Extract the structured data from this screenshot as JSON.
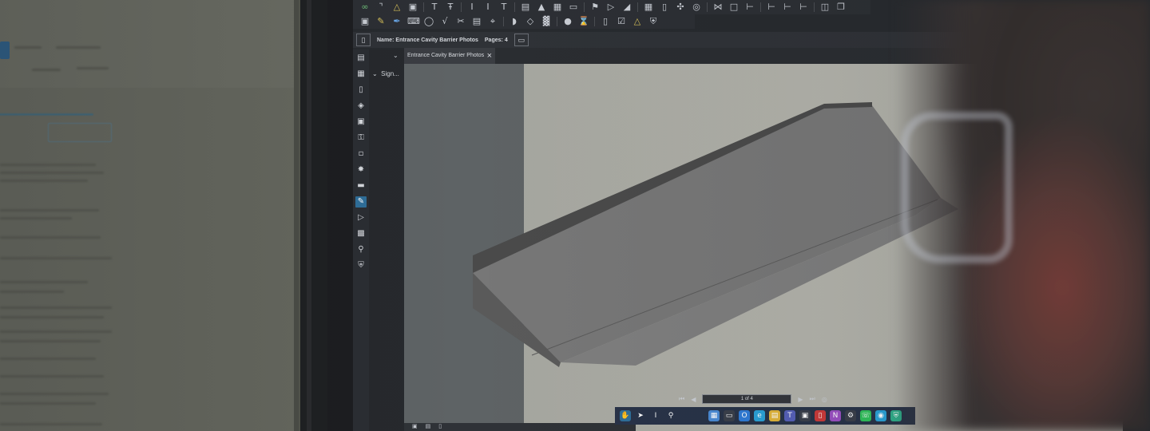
{
  "app": {
    "document_bar": {
      "name_label": "Name:",
      "name_value": "Entrance Cavity Barrier Photos",
      "pages_label": "Pages:",
      "pages_value": "4"
    },
    "tab": {
      "title": "Entrance Cavity Barrier Photos",
      "close_glyph": "×"
    },
    "panel": {
      "section_label": "Sign..."
    },
    "status": {
      "page_indicator": "1 of 4"
    }
  },
  "colors": {
    "accent": "#2f6f9a",
    "model_top": "#787878",
    "model_side": "#5f5f5f"
  },
  "icons": {
    "toolbar_row1": [
      "link-icon",
      "paperclip-icon",
      "bell-icon",
      "image-icon",
      "text-icon",
      "text-strike-icon",
      "text-cursor-icon",
      "text-insert-icon",
      "text-top-icon",
      "align-icon"
    ],
    "toolbar_row2": [
      "textbox-icon",
      "highlighter-icon",
      "pen-icon",
      "shape-icon",
      "circle-icon",
      "polygon-icon",
      "stamp-icon",
      "picture-icon",
      "crop-icon",
      "fill-icon",
      "eraser-icon"
    ],
    "left_rail": [
      "thumbnails-icon",
      "grid-icon",
      "bookmark-icon",
      "layers-icon",
      "tools-icon",
      "stamp-icon",
      "form-icon",
      "measure-icon",
      "ruler-icon",
      "signature-icon",
      "tag-icon",
      "save-icon",
      "search-icon",
      "shield-icon"
    ]
  }
}
